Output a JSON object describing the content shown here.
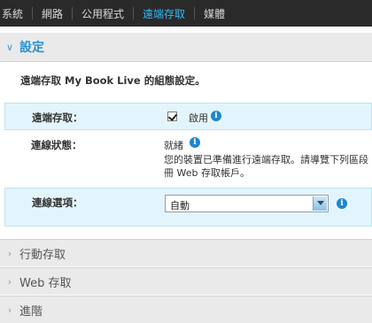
{
  "nav": {
    "items": [
      {
        "label": "系統"
      },
      {
        "label": "網路"
      },
      {
        "label": "公用程式"
      },
      {
        "label": "遠端存取",
        "active": true
      },
      {
        "label": "媒體"
      }
    ]
  },
  "settings": {
    "title": "設定",
    "description": "遠端存取 My Book Live 的組態設定。",
    "remote_access": {
      "label": "遠端存取：",
      "checkbox_label": "啟用",
      "checked": true
    },
    "connection_status": {
      "label": "連線狀態：",
      "status": "就緒",
      "detail_line1": "您的裝置已準備進行遠端存取。請導覽下列區段",
      "detail_line2": "冊 Web 存取帳戶。"
    },
    "connection_options": {
      "label": "連線選項：",
      "selected": "自動"
    }
  },
  "sections": [
    {
      "title": "行動存取"
    },
    {
      "title": "Web 存取"
    },
    {
      "title": "進階"
    }
  ],
  "icons": {
    "info": "i",
    "expanded": "∨",
    "collapsed": "›"
  },
  "colors": {
    "accent": "#2a8fd0",
    "nav_active": "#39b7f0",
    "highlight_bg": "#e3f5fc"
  }
}
